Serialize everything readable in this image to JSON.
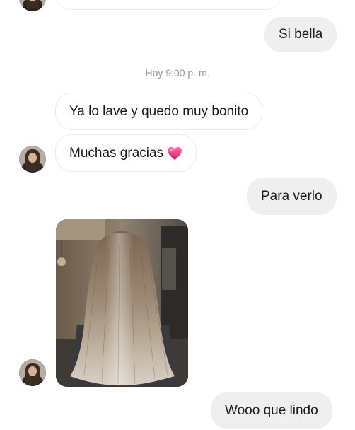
{
  "messages": {
    "si_bella": "Si bella",
    "timestamp": "Hoy 9:00 p. m.",
    "ya_lo_lave": "Ya lo lave y quedo muy bonito",
    "muchas_gracias": "Muchas gracias",
    "para_verlo": "Para verlo",
    "wooo": "Wooo que lindo"
  },
  "icons": {
    "heart": "heart-icon",
    "avatar": "avatar"
  },
  "colors": {
    "outgoing_bubble": "#efefef",
    "incoming_bubble": "#ffffff",
    "heart": "#e8327a",
    "timestamp": "#9a9a9a"
  }
}
